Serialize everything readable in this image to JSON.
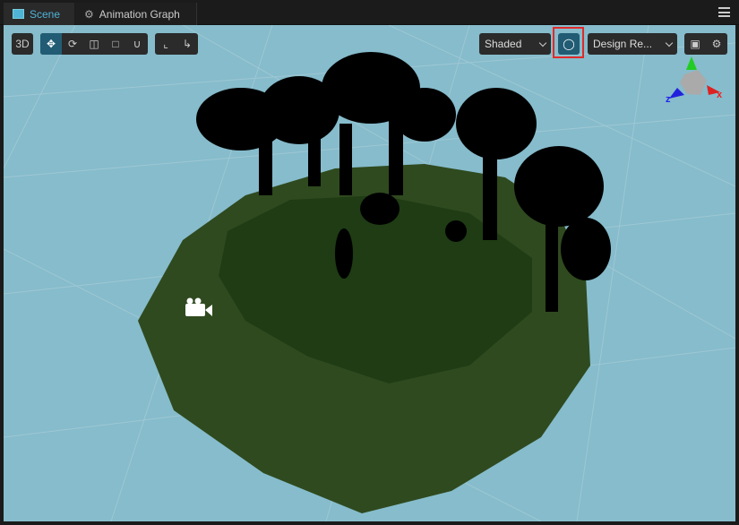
{
  "tabs": [
    {
      "label": "Scene",
      "icon": "scene-icon",
      "active": true
    },
    {
      "label": "Animation Graph",
      "icon": "animation-graph-icon",
      "active": false
    }
  ],
  "toolbar": {
    "mode_label": "3D",
    "transform_tools": [
      "move",
      "rotate",
      "scale",
      "rect",
      "snap"
    ],
    "coord_tools": [
      "local-pivot",
      "global-center"
    ],
    "shading": {
      "selected": "Shaded"
    },
    "light_toggle": {
      "active": true
    },
    "resolution": {
      "selected": "Design Re..."
    }
  },
  "gizmo": {
    "x_label": "x",
    "z_label": "z"
  },
  "colors": {
    "accent": "#4fb3d6",
    "active_bg": "#215c74",
    "sky": "#86bccc",
    "highlight": "#e02a2a",
    "ground": "#2e4a1e"
  }
}
